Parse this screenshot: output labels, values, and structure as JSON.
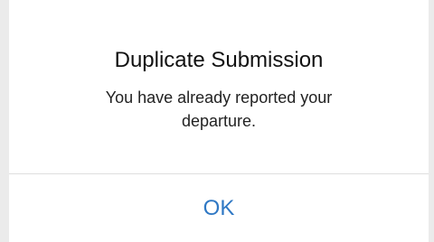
{
  "dialog": {
    "title": "Duplicate Submission",
    "message": "You have already reported your departure.",
    "ok_label": "OK"
  },
  "colors": {
    "backdrop": "#ebebeb",
    "dialog_background": "#ffffff",
    "button_text": "#2f78c4",
    "divider": "#dedede"
  }
}
